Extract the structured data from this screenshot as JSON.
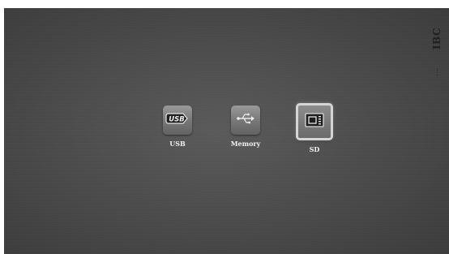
{
  "brand": {
    "text": "IBC"
  },
  "menu": {
    "items": [
      {
        "label": "USB",
        "icon": "usb-drive-icon",
        "selected": false
      },
      {
        "label": "Memory",
        "icon": "usb-symbol-icon",
        "selected": false
      },
      {
        "label": "SD",
        "icon": "sd-card-icon",
        "selected": true
      }
    ]
  },
  "colors": {
    "background": "#4c4c4c",
    "tile": "#7a7a7a",
    "selection_border": "#d6d6d6",
    "label": "#f2f2f2"
  }
}
